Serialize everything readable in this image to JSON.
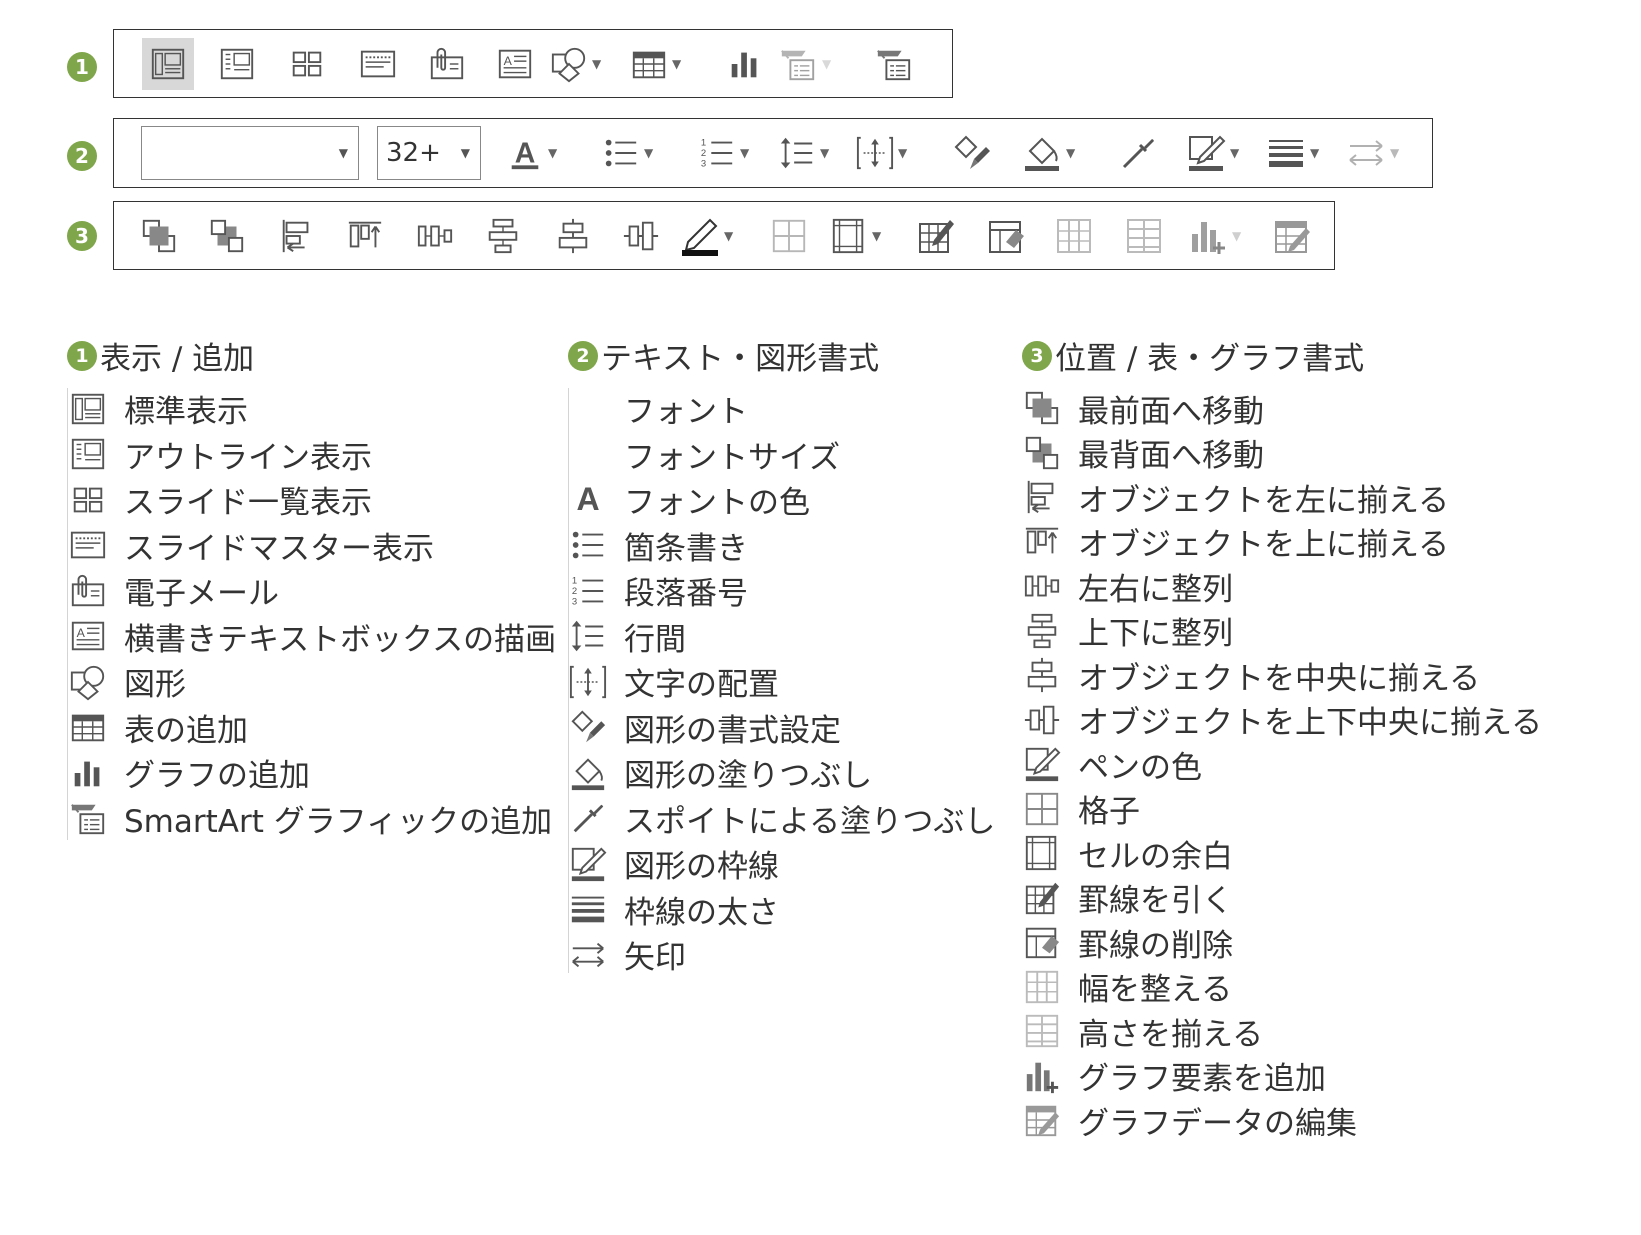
{
  "toolbars": {
    "row1_badge": "1",
    "row2_badge": "2",
    "row3_badge": "3",
    "font_name_value": "",
    "font_size_value": "32+"
  },
  "icons": {
    "row1": [
      "normal-view-icon",
      "outline-view-icon",
      "slide-sorter-icon",
      "slide-master-icon",
      "email-icon",
      "textbox-icon",
      "shape-icon",
      "table-icon",
      "chart-icon",
      "smartart-icon",
      "smartart-alt-icon"
    ],
    "row2": [
      "font-color-icon",
      "bullets-icon",
      "numbering-icon",
      "line-spacing-icon",
      "text-align-icon",
      "shape-format-icon",
      "fill-icon",
      "eyedropper-icon",
      "outline-icon",
      "line-weight-icon",
      "arrows-icon"
    ],
    "row3": [
      "bring-front-icon",
      "send-back-icon",
      "align-left-icon",
      "align-top-icon",
      "distribute-h-icon",
      "distribute-v-icon",
      "align-center-icon",
      "align-middle-icon",
      "pen-color-icon",
      "grid-icon",
      "cell-margin-icon",
      "draw-border-icon",
      "erase-border-icon",
      "distribute-cols-icon",
      "distribute-rows-icon",
      "add-chart-element-icon",
      "edit-data-icon"
    ]
  },
  "legend": {
    "col1": {
      "badge": "1",
      "title": "表示 / 追加",
      "items": [
        {
          "label": "標準表示"
        },
        {
          "label": "アウトライン表示"
        },
        {
          "label": "スライド一覧表示"
        },
        {
          "label": "スライドマスター表示"
        },
        {
          "label": "電子メール"
        },
        {
          "label": "横書きテキストボックスの描画"
        },
        {
          "label": "図形"
        },
        {
          "label": "表の追加"
        },
        {
          "label": "グラフの追加"
        },
        {
          "label": "SmartArt グラフィックの追加"
        }
      ]
    },
    "col2": {
      "badge": "2",
      "title": "テキスト・図形書式",
      "items": [
        {
          "label": "フォント"
        },
        {
          "label": "フォントサイズ"
        },
        {
          "label": "フォントの色",
          "glyph": "A"
        },
        {
          "label": "箇条書き"
        },
        {
          "label": "段落番号"
        },
        {
          "label": "行間"
        },
        {
          "label": "文字の配置"
        },
        {
          "label": "図形の書式設定"
        },
        {
          "label": "図形の塗りつぶし"
        },
        {
          "label": "スポイトによる塗りつぶし"
        },
        {
          "label": "図形の枠線"
        },
        {
          "label": "枠線の太さ"
        },
        {
          "label": "矢印"
        }
      ]
    },
    "col3": {
      "badge": "3",
      "title": "位置 / 表・グラフ書式",
      "items": [
        {
          "label": "最前面へ移動"
        },
        {
          "label": "最背面へ移動"
        },
        {
          "label": "オブジェクトを左に揃える"
        },
        {
          "label": "オブジェクトを上に揃える"
        },
        {
          "label": "左右に整列"
        },
        {
          "label": "上下に整列"
        },
        {
          "label": "オブジェクトを中央に揃える"
        },
        {
          "label": "オブジェクトを上下中央に揃える"
        },
        {
          "label": "ペンの色"
        },
        {
          "label": "格子"
        },
        {
          "label": "セルの余白"
        },
        {
          "label": "罫線を引く"
        },
        {
          "label": "罫線の削除"
        },
        {
          "label": "幅を整える"
        },
        {
          "label": "高さを揃える"
        },
        {
          "label": "グラフ要素を追加"
        },
        {
          "label": "グラフデータの編集"
        }
      ]
    }
  },
  "colors": {
    "badge_green": "#7fa64a",
    "border": "#333333",
    "icon_gray": "#555555",
    "disabled_gray": "#bbbbbb"
  }
}
